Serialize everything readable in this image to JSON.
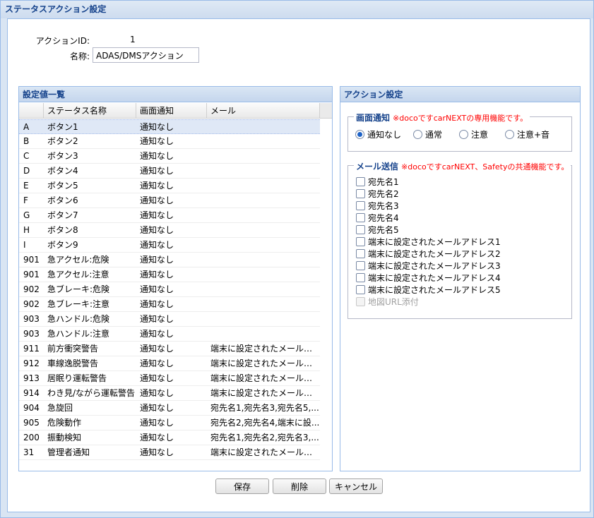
{
  "window": {
    "title": "ステータスアクション設定"
  },
  "form": {
    "action_id_label": "アクションID:",
    "action_id_value": "1",
    "name_label": "名称:",
    "name_value": "ADAS/DMSアクション"
  },
  "settings_panel": {
    "title": "設定値一覧",
    "columns": [
      "",
      "ステータス名称",
      "画面通知",
      "メール"
    ],
    "rows": [
      {
        "code": "A",
        "name": "ボタン1",
        "notify": "通知なし",
        "mail": ""
      },
      {
        "code": "B",
        "name": "ボタン2",
        "notify": "通知なし",
        "mail": ""
      },
      {
        "code": "C",
        "name": "ボタン3",
        "notify": "通知なし",
        "mail": ""
      },
      {
        "code": "D",
        "name": "ボタン4",
        "notify": "通知なし",
        "mail": ""
      },
      {
        "code": "E",
        "name": "ボタン5",
        "notify": "通知なし",
        "mail": ""
      },
      {
        "code": "F",
        "name": "ボタン6",
        "notify": "通知なし",
        "mail": ""
      },
      {
        "code": "G",
        "name": "ボタン7",
        "notify": "通知なし",
        "mail": ""
      },
      {
        "code": "H",
        "name": "ボタン8",
        "notify": "通知なし",
        "mail": ""
      },
      {
        "code": "I",
        "name": "ボタン9",
        "notify": "通知なし",
        "mail": ""
      },
      {
        "code": "901",
        "name": "急アクセル:危険",
        "notify": "通知なし",
        "mail": ""
      },
      {
        "code": "901",
        "name": "急アクセル:注意",
        "notify": "通知なし",
        "mail": ""
      },
      {
        "code": "902",
        "name": "急ブレーキ:危険",
        "notify": "通知なし",
        "mail": ""
      },
      {
        "code": "902",
        "name": "急ブレーキ:注意",
        "notify": "通知なし",
        "mail": ""
      },
      {
        "code": "903",
        "name": "急ハンドル:危険",
        "notify": "通知なし",
        "mail": ""
      },
      {
        "code": "903",
        "name": "急ハンドル:注意",
        "notify": "通知なし",
        "mail": ""
      },
      {
        "code": "911",
        "name": "前方衝突警告",
        "notify": "通知なし",
        "mail": "端末に設定されたメールアドレ..."
      },
      {
        "code": "912",
        "name": "車線逸脱警告",
        "notify": "通知なし",
        "mail": "端末に設定されたメールアドレ..."
      },
      {
        "code": "913",
        "name": "居眠り運転警告",
        "notify": "通知なし",
        "mail": "端末に設定されたメールアドレ..."
      },
      {
        "code": "914",
        "name": "わき見/ながら運転警告",
        "notify": "通知なし",
        "mail": "端末に設定されたメールアドレ..."
      },
      {
        "code": "904",
        "name": "急旋回",
        "notify": "通知なし",
        "mail": "宛先名1,宛先名3,宛先名5,..."
      },
      {
        "code": "905",
        "name": "危険動作",
        "notify": "通知なし",
        "mail": "宛先名2,宛先名4,端末に設..."
      },
      {
        "code": "200",
        "name": "振動検知",
        "notify": "通知なし",
        "mail": "宛先名1,宛先名2,宛先名3,..."
      },
      {
        "code": "31",
        "name": "管理者通知",
        "notify": "通知なし",
        "mail": "端末に設定されたメールアドレ..."
      }
    ]
  },
  "action_panel": {
    "title": "アクション設定",
    "screen_notify": {
      "legend": "画面通知",
      "note": "※docoですcarNEXTの専用機能です。",
      "options": [
        "通知なし",
        "通常",
        "注意",
        "注意+音"
      ],
      "selected": 0
    },
    "mail_send": {
      "legend": "メール送信",
      "note": "※docoですcarNEXT、Safetyの共通機能です。",
      "options": [
        "宛先名1",
        "宛先名2",
        "宛先名3",
        "宛先名4",
        "宛先名5",
        "端末に設定されたメールアドレス1",
        "端末に設定されたメールアドレス2",
        "端末に設定されたメールアドレス3",
        "端末に設定されたメールアドレス4",
        "端末に設定されたメールアドレス5"
      ],
      "map_url": "地図URL添付"
    }
  },
  "buttons": {
    "save": "保存",
    "delete": "削除",
    "cancel": "キャンセル"
  },
  "colors": {
    "header_text": "#15428b",
    "note_red": "#ff0000",
    "selected_row": "#dfe8f6"
  }
}
